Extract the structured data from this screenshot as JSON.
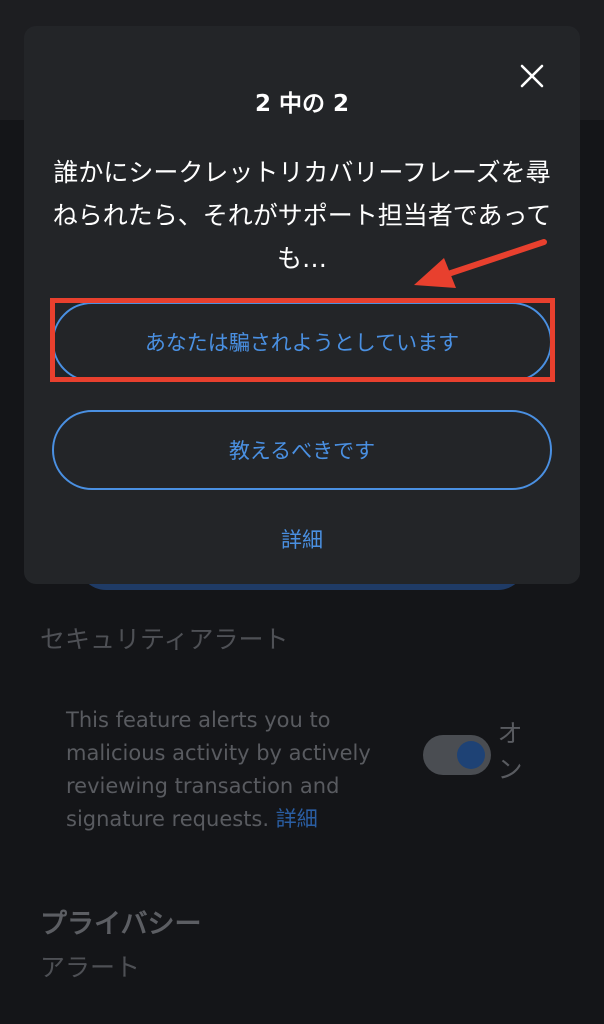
{
  "background": {
    "security_alert_label": "セキュリティアラート",
    "security_description": "This feature alerts you to malicious activity by actively reviewing transaction and signature requests.",
    "security_link": "詳細",
    "toggle_label": "オン",
    "privacy_heading": "プライバシー",
    "alert_label": "アラート"
  },
  "modal": {
    "title": "2 中の 2",
    "question": "誰かにシークレットリカバリーフレーズを尋ねられたら、それがサポート担当者であっても…",
    "option_1": "あなたは騙されようとしています",
    "option_2": "教えるべきです",
    "more_link": "詳細"
  },
  "colors": {
    "accent": "#4a90e2",
    "annotation": "#e8402e",
    "modal_bg": "#232528",
    "page_bg": "#141518"
  }
}
